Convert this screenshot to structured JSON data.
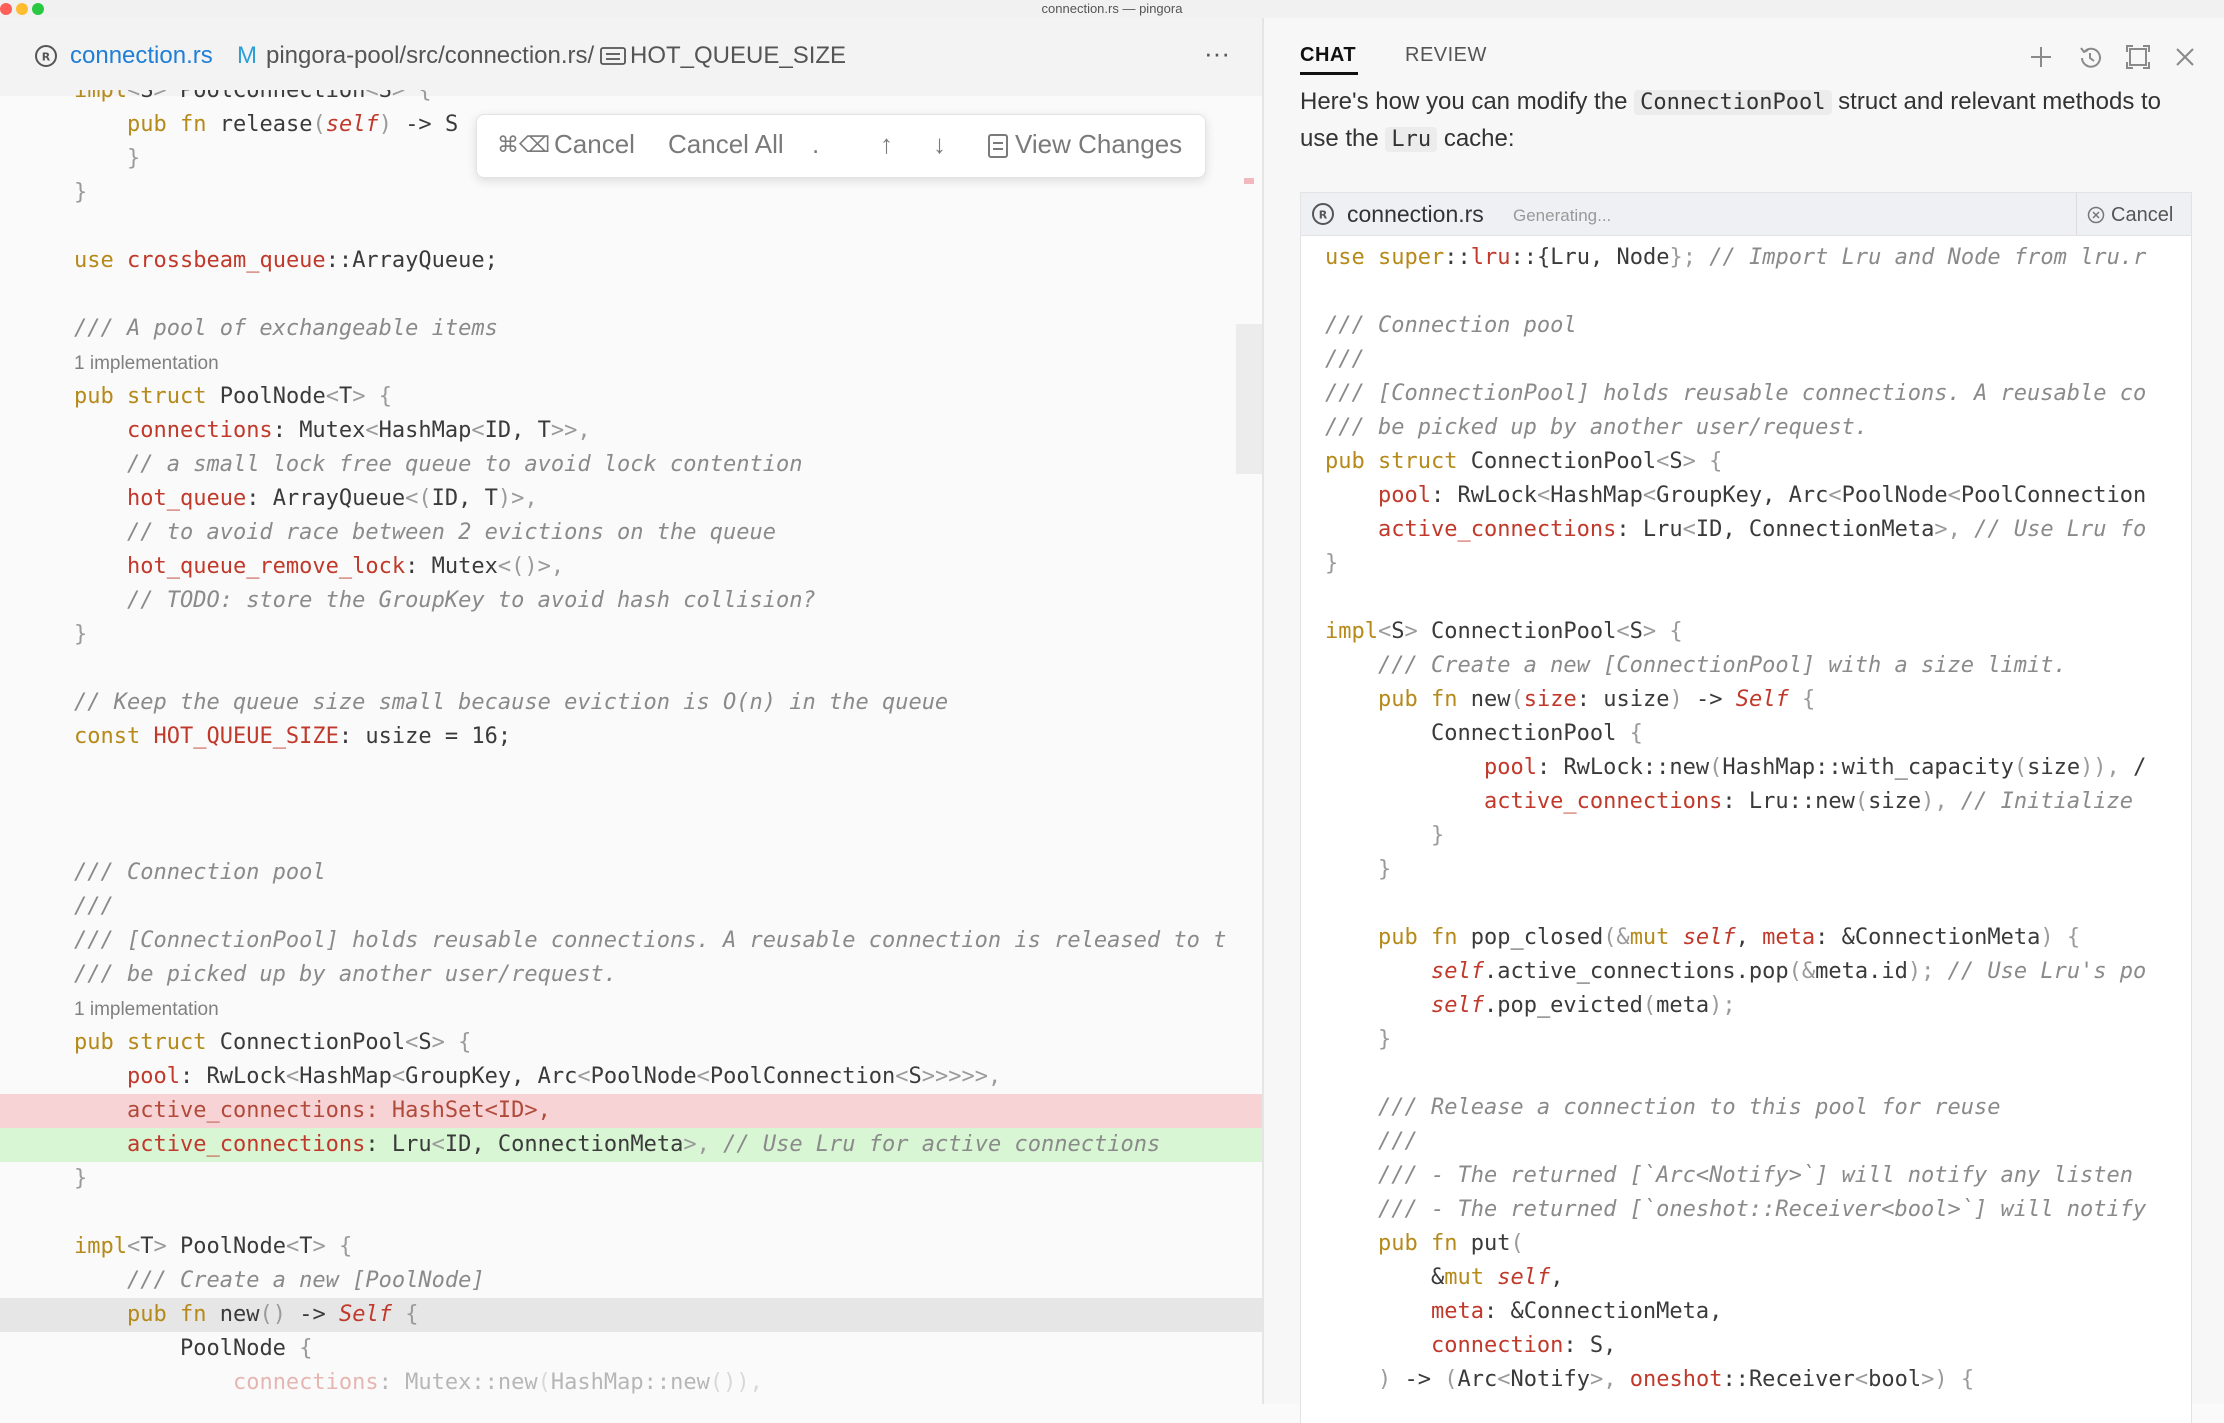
{
  "window": {
    "title": "connection.rs — pingora"
  },
  "editor": {
    "tab": {
      "filename": "connection.rs",
      "status": "M",
      "path": "pingora-pool/src/connection.rs/",
      "symbol": "HOT_QUEUE_SIZE",
      "more": "···"
    },
    "toolbar": {
      "shortcut": "⌘⌫",
      "cancel": "Cancel",
      "cancel_all": "Cancel All",
      "dot": ".",
      "up": "↑",
      "down": "↓",
      "view_changes": "View Changes"
    },
    "lines": [
      {
        "t": "impl<S> PoolConnection<S> {"
      },
      {
        "t": "    pub fn release(self) -> S"
      },
      {
        "t": "    }"
      },
      {
        "t": "}"
      },
      {
        "t": ""
      },
      {
        "t": "use crossbeam_queue::ArrayQueue;"
      },
      {
        "t": ""
      },
      {
        "t": "/// A pool of exchangeable items"
      },
      {
        "t": "1 implementation"
      },
      {
        "t": "pub struct PoolNode<T> {"
      },
      {
        "t": "    connections: Mutex<HashMap<ID, T>>,"
      },
      {
        "t": "    // a small lock free queue to avoid lock contention"
      },
      {
        "t": "    hot_queue: ArrayQueue<(ID, T)>,"
      },
      {
        "t": "    // to avoid race between 2 evictions on the queue"
      },
      {
        "t": "    hot_queue_remove_lock: Mutex<()>,"
      },
      {
        "t": "    // TODO: store the GroupKey to avoid hash collision?"
      },
      {
        "t": "}"
      },
      {
        "t": ""
      },
      {
        "t": "// Keep the queue size small because eviction is O(n) in the queue"
      },
      {
        "t": "const HOT_QUEUE_SIZE: usize = 16;"
      },
      {
        "t": ""
      },
      {
        "t": ""
      },
      {
        "t": ""
      },
      {
        "t": "/// Connection pool"
      },
      {
        "t": "///"
      },
      {
        "t": "/// [ConnectionPool] holds reusable connections. A reusable connection is released to t"
      },
      {
        "t": "/// be picked up by another user/request."
      },
      {
        "t": "1 implementation"
      },
      {
        "t": "pub struct ConnectionPool<S> {"
      },
      {
        "t": "    pool: RwLock<HashMap<GroupKey, Arc<PoolNode<PoolConnection<S>>>>>,"
      },
      {
        "t": "    active_connections: HashSet<ID>,"
      },
      {
        "t": "    active_connections: Lru<ID, ConnectionMeta>, // Use Lru for active connections"
      },
      {
        "t": "}"
      },
      {
        "t": ""
      },
      {
        "t": "impl<T> PoolNode<T> {"
      },
      {
        "t": "    /// Create a new [PoolNode]"
      },
      {
        "t": "    pub fn new() -> Self {"
      },
      {
        "t": "        PoolNode {"
      },
      {
        "t": "            connections: Mutex::new(HashMap::new()),"
      }
    ]
  },
  "chat": {
    "tabs": [
      "CHAT",
      "REVIEW"
    ],
    "intro": {
      "pre": "Here's how you can modify the ",
      "code1": "ConnectionPool",
      "mid": " struct and relevant methods to use the ",
      "code2": "Lru",
      "post": " cache:"
    },
    "codeblock": {
      "filename": "connection.rs",
      "status": "Generating...",
      "cancel": "Cancel"
    },
    "lines": [
      {
        "t": "use super::lru::{Lru, Node}; // Import Lru and Node from lru.r"
      },
      {
        "t": ""
      },
      {
        "t": "/// Connection pool"
      },
      {
        "t": "///"
      },
      {
        "t": "/// [ConnectionPool] holds reusable connections. A reusable co"
      },
      {
        "t": "/// be picked up by another user/request."
      },
      {
        "t": "pub struct ConnectionPool<S> {"
      },
      {
        "t": "    pool: RwLock<HashMap<GroupKey, Arc<PoolNode<PoolConnection"
      },
      {
        "t": "    active_connections: Lru<ID, ConnectionMeta>, // Use Lru fo"
      },
      {
        "t": "}"
      },
      {
        "t": ""
      },
      {
        "t": "impl<S> ConnectionPool<S> {"
      },
      {
        "t": "    /// Create a new [ConnectionPool] with a size limit."
      },
      {
        "t": "    pub fn new(size: usize) -> Self {"
      },
      {
        "t": "        ConnectionPool {"
      },
      {
        "t": "            pool: RwLock::new(HashMap::with_capacity(size)), /"
      },
      {
        "t": "            active_connections: Lru::new(size), // Initialize "
      },
      {
        "t": "        }"
      },
      {
        "t": "    }"
      },
      {
        "t": ""
      },
      {
        "t": "    pub fn pop_closed(&mut self, meta: &ConnectionMeta) {"
      },
      {
        "t": "        self.active_connections.pop(&meta.id); // Use Lru's po"
      },
      {
        "t": "        self.pop_evicted(meta);"
      },
      {
        "t": "    }"
      },
      {
        "t": ""
      },
      {
        "t": "    /// Release a connection to this pool for reuse"
      },
      {
        "t": "    ///"
      },
      {
        "t": "    /// - The returned [`Arc<Notify>`] will notify any listen"
      },
      {
        "t": "    /// - The returned [`oneshot::Receiver<bool>`] will notify"
      },
      {
        "t": "    pub fn put("
      },
      {
        "t": "        &mut self,"
      },
      {
        "t": "        meta: &ConnectionMeta,"
      },
      {
        "t": "        connection: S,"
      },
      {
        "t": "    ) -> (Arc<Notify>, oneshot::Receiver<bool>) {"
      }
    ]
  },
  "colors": {
    "keyword": "#b58a1a",
    "field": "#c0392b",
    "comment": "#8a8a8a",
    "added": "#d8f5d4",
    "removed": "#f8d3d6",
    "link": "#1f7ed6"
  }
}
